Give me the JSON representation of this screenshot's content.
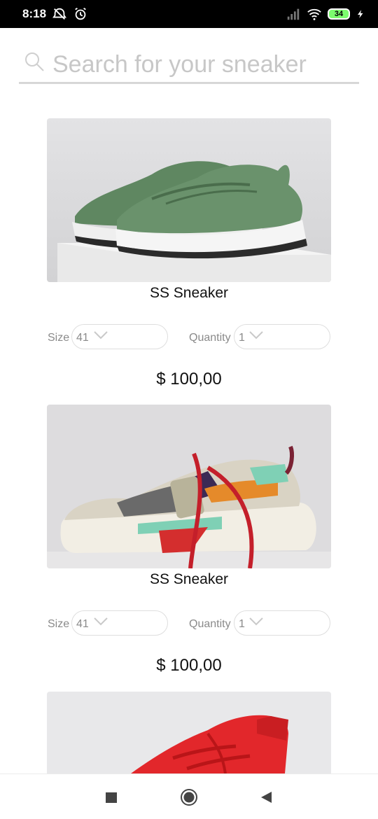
{
  "status_bar": {
    "time": "8:18",
    "battery": "34",
    "icons": [
      "alarm-off-icon",
      "alarm-clock-icon",
      "signal-icon",
      "wifi-icon",
      "battery-icon",
      "charging-icon"
    ]
  },
  "search": {
    "placeholder": "Search for your sneaker",
    "value": ""
  },
  "products": [
    {
      "name": "SS Sneaker",
      "size_label": "Size",
      "size_value": "41",
      "quantity_label": "Quantity",
      "quantity_value": "1",
      "price": "$ 100,00",
      "image": "green-sneaker-image"
    },
    {
      "name": "SS Sneaker",
      "size_label": "Size",
      "size_value": "41",
      "quantity_label": "Quantity",
      "quantity_value": "1",
      "price": "$ 100,00",
      "image": "multicolor-sneaker-image"
    },
    {
      "image": "red-sneaker-image"
    }
  ],
  "nav": {
    "icons": [
      "recents-square-icon",
      "home-circle-icon",
      "back-triangle-icon"
    ]
  },
  "colors": {
    "status_bar_bg": "#000000",
    "battery_fill": "#7CFC6E",
    "placeholder": "#c7c7c7",
    "divider": "#d7d7d7"
  }
}
